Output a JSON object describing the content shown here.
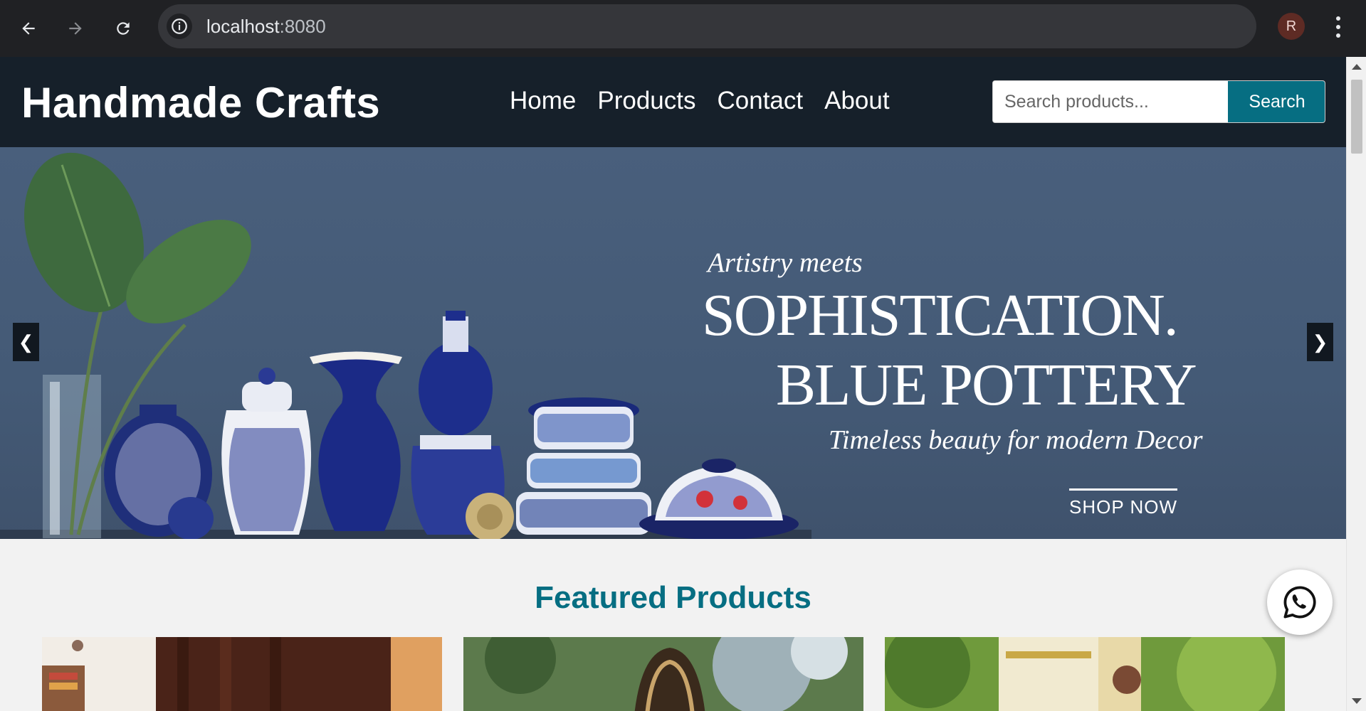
{
  "browser": {
    "url_host": "localhost",
    "url_port": ":8080",
    "profile_initial": "R"
  },
  "site": {
    "brand": "Handmade Crafts",
    "nav": [
      "Home",
      "Products",
      "Contact",
      "About"
    ],
    "search": {
      "placeholder": "Search products...",
      "button_label": "Search"
    }
  },
  "hero": {
    "kicker": "Artistry meets",
    "headline_1": "SOPHISTICATION.",
    "headline_2": "BLUE POTTERY",
    "subtitle": "Timeless beauty for modern Decor",
    "cta": "SHOP NOW",
    "prev_label": "❮",
    "next_label": "❯"
  },
  "featured": {
    "title": "Featured Products"
  },
  "colors": {
    "header_bg": "#16202a",
    "accent": "#066e82",
    "hero_bg": "#495f7c"
  }
}
